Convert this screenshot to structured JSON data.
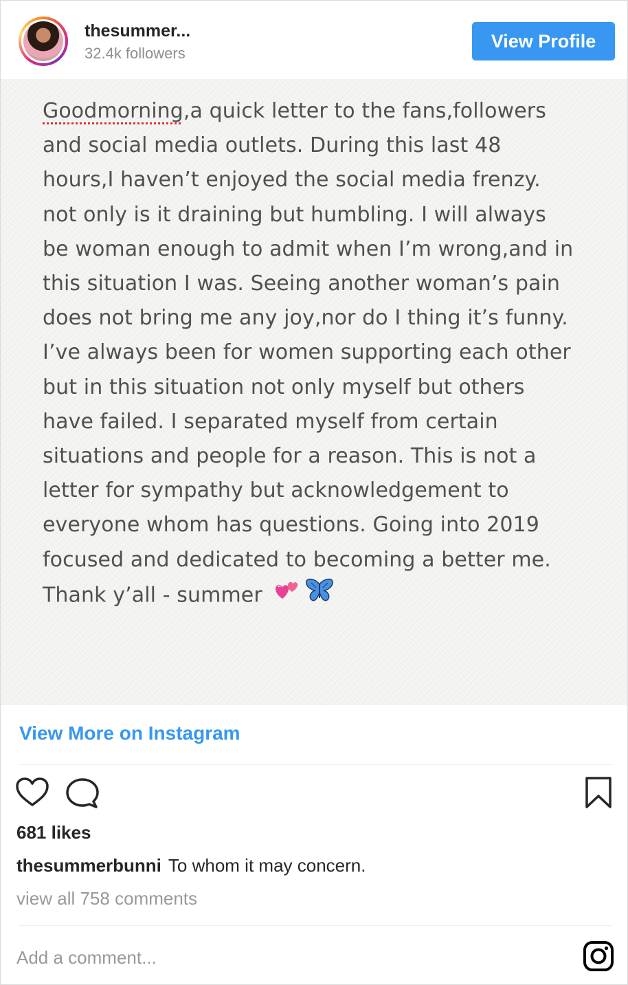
{
  "header": {
    "username": "thesummer...",
    "followers": "32.4k followers",
    "view_profile_label": "View Profile",
    "accent_color": "#3897f0"
  },
  "post": {
    "text_first": "Goodmorning",
    "text_rest": ",a quick letter to the fans,followers\nand social media outlets. During this last 48\nhours,I haven’t enjoyed the social media frenzy.\nnot only is it draining but humbling. I will always\nbe woman enough to admit when I’m wrong,and in\nthis situation I was. Seeing another woman’s pain\ndoes not bring me any joy,nor do I thing it’s funny.\nI’ve always been for women supporting each other\nbut in this situation not only myself but others\nhave failed. I separated myself from certain\nsituations and people for a reason. This is not a\nletter for sympathy but acknowledgement to\neveryone whom has questions. Going into 2019\nfocused and dedicated to becoming a better me.\nThank y’all - summer ",
    "emojis": [
      "revolving-hearts-icon",
      "butterfly-icon"
    ]
  },
  "view_more_label": "View More on Instagram",
  "actions": {
    "icons": [
      "heart-icon",
      "comment-icon",
      "bookmark-icon"
    ]
  },
  "likes": "681 likes",
  "caption": {
    "username": "thesummerbunni",
    "text": "To whom it may concern."
  },
  "view_comments": "view all 758 comments",
  "comment_placeholder": "Add a comment...",
  "footer_icon": "instagram-logo-icon"
}
